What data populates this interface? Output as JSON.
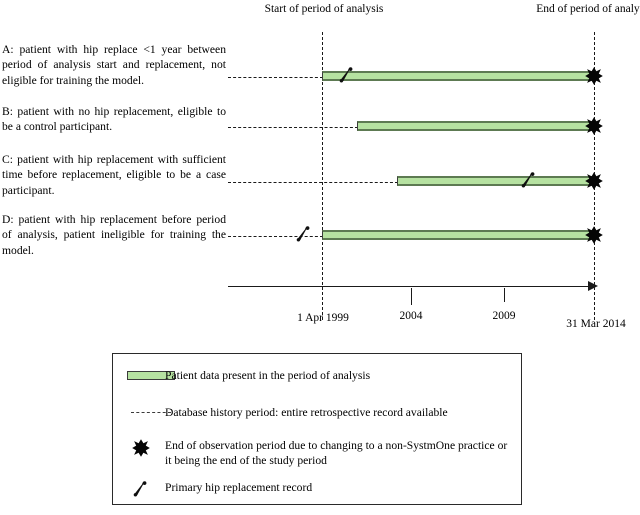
{
  "figure": {
    "type": "timeline-diagram",
    "period_start_caption": "Start of period of analysis",
    "period_end_caption": "End of period of analysis"
  },
  "patients": [
    {
      "id": "A",
      "description": "A: patient with hip replace <1 year between period of analysis start and replacement, not eligible for training the model.",
      "bar_start_label": "1 Apr 1999",
      "bar_end_label": "31 Mar 2014",
      "has_hip_marker": true,
      "hip_marker_position": "just after period start",
      "has_end_marker": true
    },
    {
      "id": "B",
      "description": "B: patient with no hip replacement, eligible to be a control participant.",
      "bar_start_label": "after 1 Apr 1999",
      "bar_end_label": "31 Mar 2014",
      "has_hip_marker": false,
      "has_end_marker": true
    },
    {
      "id": "C",
      "description": "C: patient with hip replacement with sufficient time before replacement, eligible to be a case participant.",
      "bar_start_label": "circa 2003",
      "bar_end_label": "31 Mar 2014",
      "has_hip_marker": true,
      "hip_marker_position": "near 2013, before end of period",
      "has_end_marker": true
    },
    {
      "id": "D",
      "description": "D: patient with hip replacement before period of analysis, patient ineligible for training the model.",
      "bar_start_label": "1 Apr 1999",
      "bar_end_label": "31 Mar 2014",
      "has_hip_marker": true,
      "hip_marker_position": "before period of analysis start",
      "has_end_marker": true
    }
  ],
  "axis": {
    "ticks": [
      {
        "label": "1 Apr 1999",
        "kind": "dashed-boundary"
      },
      {
        "label": "2004",
        "kind": "major-tick"
      },
      {
        "label": "2009",
        "kind": "minor-tick"
      },
      {
        "label": "31 Mar 2014",
        "kind": "dashed-boundary"
      }
    ],
    "arrow_direction": "right"
  },
  "legend": {
    "items": [
      {
        "key": "green-bar-swatch",
        "label": "Patient data present in the period of analysis"
      },
      {
        "key": "dashed-line",
        "label": "Database history period: entire retrospective record available"
      },
      {
        "key": "x-marker",
        "label": "End of observation period due to changing to a non-SystmOne practice or it being the end of the study period"
      },
      {
        "key": "hip-marker",
        "label": "Primary hip replacement record"
      }
    ]
  },
  "colors": {
    "bar_fill": "#b6e2a1",
    "bar_edge": "#5d7a52",
    "line": "#1a1a1a",
    "background": "#ffffff"
  }
}
